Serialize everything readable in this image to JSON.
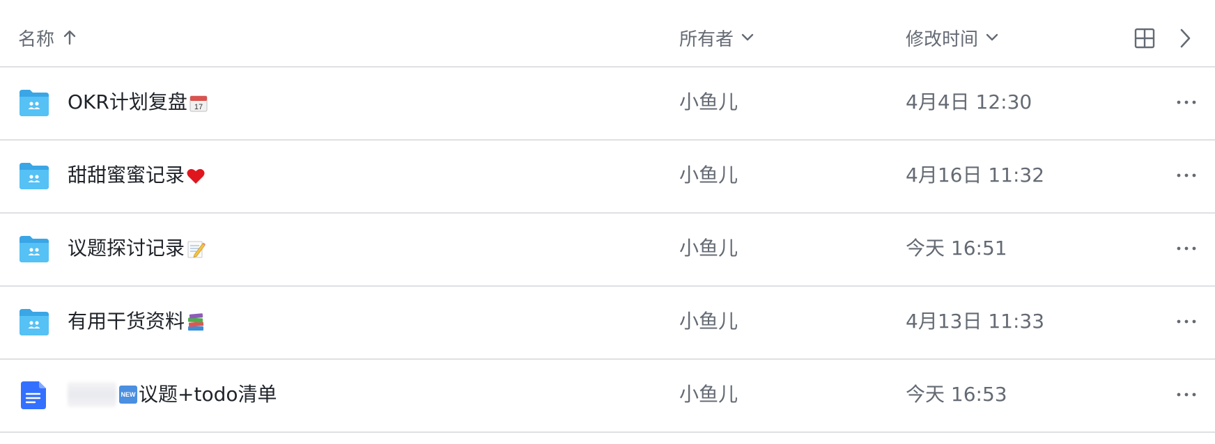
{
  "header": {
    "name_label": "名称",
    "owner_label": "所有者",
    "modified_label": "修改时间"
  },
  "colors": {
    "folder_blue": "#4cb8f0",
    "doc_blue": "#3370ff",
    "divider": "#dee0e3",
    "secondary_text": "#646a73"
  },
  "rows": [
    {
      "type": "folder",
      "name": "OKR计划复盘",
      "emoji": "calendar-icon",
      "owner": "小鱼儿",
      "modified": "4月4日 12:30"
    },
    {
      "type": "folder",
      "name": "甜甜蜜蜜记录",
      "emoji": "heart-icon",
      "owner": "小鱼儿",
      "modified": "4月16日 11:32"
    },
    {
      "type": "folder",
      "name": "议题探讨记录",
      "emoji": "memo-icon",
      "owner": "小鱼儿",
      "modified": "今天 16:51"
    },
    {
      "type": "folder",
      "name": "有用干货资料",
      "emoji": "books-icon",
      "owner": "小鱼儿",
      "modified": "4月13日 11:33"
    },
    {
      "type": "doc",
      "name": "议题+todo清单",
      "badge": "NEW",
      "owner": "小鱼儿",
      "modified": "今天 16:53"
    }
  ]
}
